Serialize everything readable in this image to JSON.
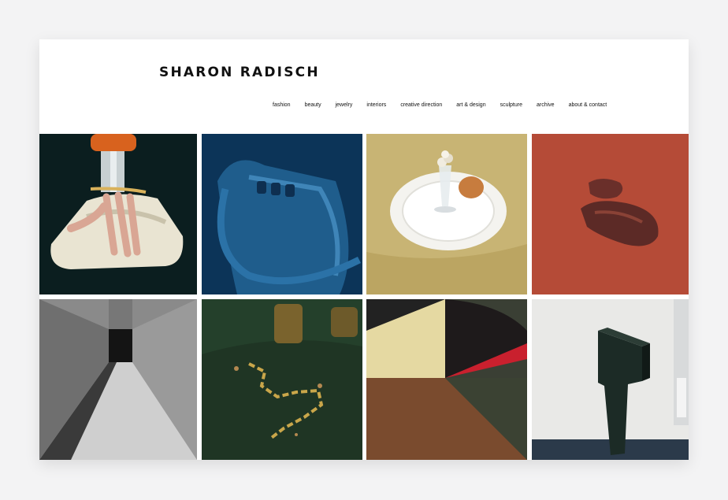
{
  "header": {
    "logo": "SHARON RADISCH"
  },
  "nav": {
    "items": [
      {
        "label": "fashion"
      },
      {
        "label": "beauty"
      },
      {
        "label": "jewelry"
      },
      {
        "label": "interiors"
      },
      {
        "label": "creative direction"
      },
      {
        "label": "art & design"
      },
      {
        "label": "sculpture"
      },
      {
        "label": "archive"
      },
      {
        "label": "about & contact"
      }
    ]
  },
  "colors": {
    "page_background": "#f3f3f4",
    "card_background": "#ffffff",
    "text": "#111111"
  }
}
